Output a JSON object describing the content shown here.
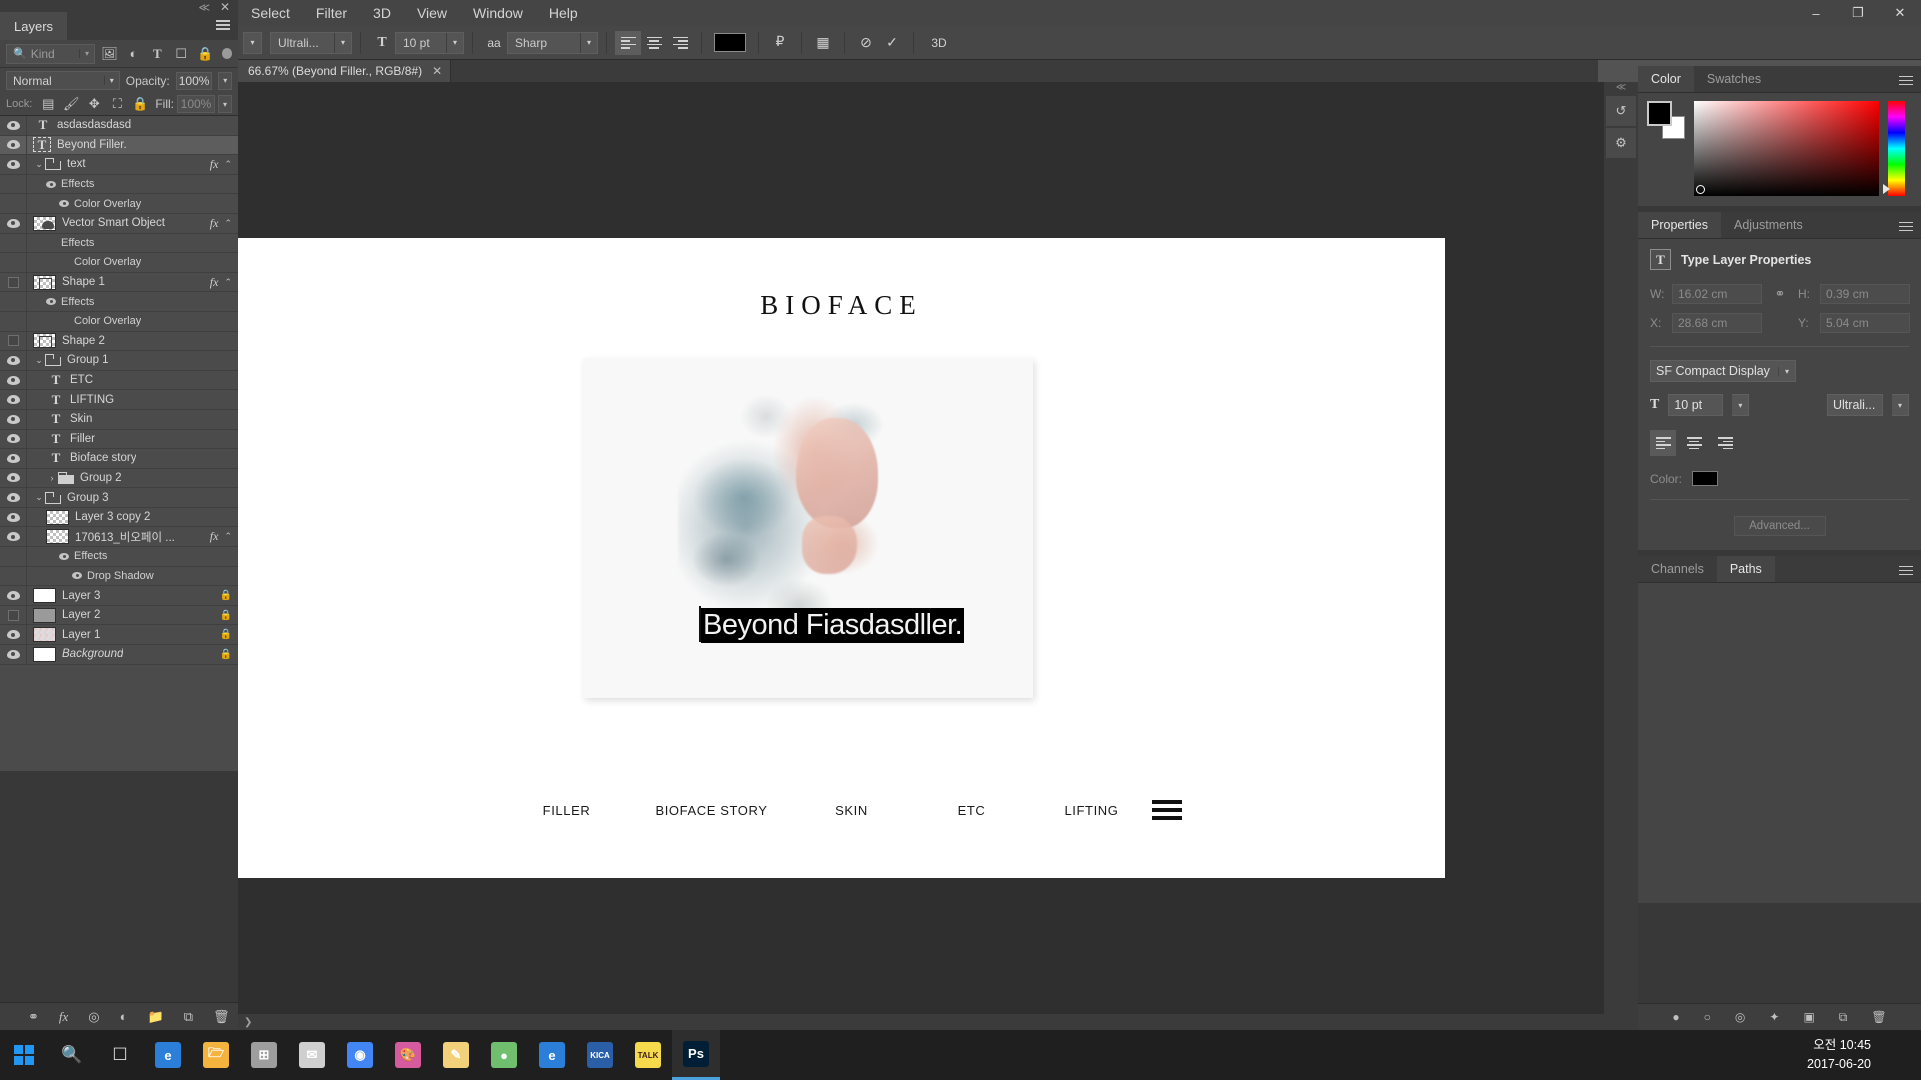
{
  "menubar": {
    "items": [
      "Select",
      "Filter",
      "3D",
      "View",
      "Window",
      "Help"
    ],
    "window_controls": {
      "minimize": "–",
      "maximize": "❐",
      "close": "✕"
    }
  },
  "options_bar": {
    "font_family": "Ultrali...",
    "font_size": "10 pt",
    "antialias_label": "aa",
    "antialias_value": "Sharp",
    "color_swatch": "#000000",
    "align_left": "align-left",
    "align_center": "align-center",
    "align_right": "align-right",
    "warp_text": "warp-text-icon",
    "char_panel": "character-panel-icon",
    "cancel": "cancel-icon",
    "commit": "commit-icon",
    "threed": "3D"
  },
  "layers_panel": {
    "tab_label": "Layers",
    "filter_placeholder": "Kind",
    "filter_icons": [
      "image-filter-icon",
      "adjustment-filter-icon",
      "type-filter-icon",
      "shape-filter-icon",
      "smartobject-filter-icon"
    ],
    "blend_mode": "Normal",
    "opacity_label": "Opacity:",
    "opacity_value": "100%",
    "lock_label": "Lock:",
    "fill_label": "Fill:",
    "fill_value": "100%",
    "lock_icons": [
      "lock-transparent-icon",
      "lock-image-icon",
      "lock-position-icon",
      "lock-artboard-icon",
      "lock-all-icon"
    ],
    "rows": [
      {
        "kind": "type",
        "name": "asdasdasdasd",
        "visible": true,
        "indent": 0,
        "selected": false,
        "fx": false
      },
      {
        "kind": "type-boxed",
        "name": "Beyond Filler.",
        "visible": true,
        "indent": 0,
        "selected": true,
        "fx": false
      },
      {
        "kind": "group-open",
        "name": "text",
        "visible": true,
        "indent": 0,
        "selected": false,
        "fx": true
      },
      {
        "kind": "effects",
        "name": "Effects",
        "visible": true,
        "indent": 1,
        "selected": false,
        "fx": false
      },
      {
        "kind": "effect-item",
        "name": "Color Overlay",
        "visible": true,
        "indent": 2,
        "selected": false,
        "fx": false
      },
      {
        "kind": "smart-object",
        "name": "Vector Smart Object",
        "visible": true,
        "indent": 0,
        "selected": false,
        "fx": true
      },
      {
        "kind": "effects-noeye",
        "name": "Effects",
        "visible": false,
        "indent": 1,
        "selected": false,
        "fx": false
      },
      {
        "kind": "effect-item-noeye",
        "name": "Color Overlay",
        "visible": false,
        "indent": 2,
        "selected": false,
        "fx": false
      },
      {
        "kind": "shape",
        "name": "Shape 1",
        "visible": false,
        "indent": 0,
        "selected": false,
        "fx": true
      },
      {
        "kind": "effects",
        "name": "Effects",
        "visible": true,
        "indent": 1,
        "selected": false,
        "fx": false
      },
      {
        "kind": "effect-item-noeye",
        "name": "Color Overlay",
        "visible": false,
        "indent": 2,
        "selected": false,
        "fx": false
      },
      {
        "kind": "shape",
        "name": "Shape 2",
        "visible": false,
        "indent": 0,
        "selected": false,
        "fx": false
      },
      {
        "kind": "group-open",
        "name": "Group 1",
        "visible": true,
        "indent": 0,
        "selected": false,
        "fx": false
      },
      {
        "kind": "type",
        "name": "ETC",
        "visible": true,
        "indent": 1,
        "selected": false,
        "fx": false
      },
      {
        "kind": "type",
        "name": "LIFTING",
        "visible": true,
        "indent": 1,
        "selected": false,
        "fx": false
      },
      {
        "kind": "type",
        "name": "Skin",
        "visible": true,
        "indent": 1,
        "selected": false,
        "fx": false
      },
      {
        "kind": "type",
        "name": "Filler",
        "visible": true,
        "indent": 1,
        "selected": false,
        "fx": false
      },
      {
        "kind": "type",
        "name": "Bioface story",
        "visible": true,
        "indent": 1,
        "selected": false,
        "fx": false
      },
      {
        "kind": "group-closed",
        "name": "Group 2",
        "visible": true,
        "indent": 1,
        "selected": false,
        "fx": false
      },
      {
        "kind": "group-open",
        "name": "Group 3",
        "visible": true,
        "indent": 0,
        "selected": false,
        "fx": false
      },
      {
        "kind": "raster",
        "name": "Layer 3 copy 2",
        "visible": true,
        "indent": 1,
        "selected": false,
        "fx": false
      },
      {
        "kind": "raster",
        "name": "170613_비오페이 ...",
        "visible": true,
        "indent": 1,
        "selected": false,
        "fx": true
      },
      {
        "kind": "effects",
        "name": "Effects",
        "visible": true,
        "indent": 2,
        "selected": false,
        "fx": false
      },
      {
        "kind": "effect-item",
        "name": "Drop Shadow",
        "visible": true,
        "indent": 3,
        "selected": false,
        "fx": false
      },
      {
        "kind": "raster-white",
        "name": "Layer 3",
        "visible": true,
        "indent": 0,
        "selected": false,
        "locked": true
      },
      {
        "kind": "raster-photo",
        "name": "Layer 2",
        "visible": false,
        "indent": 0,
        "selected": false,
        "locked": true
      },
      {
        "kind": "raster-photo2",
        "name": "Layer 1",
        "visible": true,
        "indent": 0,
        "selected": false,
        "locked": true
      },
      {
        "kind": "raster-white",
        "name": "Background",
        "visible": true,
        "indent": 0,
        "selected": false,
        "locked": true,
        "italic": true
      }
    ],
    "bottom_icons": [
      "link-layers-icon",
      "add-style-icon",
      "add-mask-icon",
      "adjustment-layer-icon",
      "new-group-icon",
      "new-layer-icon",
      "delete-layer-icon"
    ]
  },
  "document": {
    "tab_title": "66.67% (Beyond Filler., RGB/8#)",
    "close_glyph": "✕"
  },
  "canvas": {
    "brand_title": "BIOFACE",
    "selected_text": "Beyond Fiasdasdller.",
    "nav_items": [
      "FILLER",
      "BIOFACE STORY",
      "SKIN",
      "ETC",
      "LIFTING"
    ],
    "hamburger": "hamburger-menu-icon"
  },
  "right_rail": {
    "icons": [
      "history-icon",
      "properties-rail-icon"
    ]
  },
  "color_panel": {
    "tabs": [
      "Color",
      "Swatches"
    ],
    "active_tab": "Color",
    "foreground": "#000000",
    "background": "#ffffff"
  },
  "properties_panel": {
    "tabs": [
      "Properties",
      "Adjustments"
    ],
    "active_tab": "Properties",
    "title": "Type Layer Properties",
    "w_label": "W:",
    "w_value": "16.02 cm",
    "h_label": "H:",
    "h_value": "0.39 cm",
    "x_label": "X:",
    "x_value": "28.68 cm",
    "y_label": "Y:",
    "y_value": "5.04 cm",
    "link_icon": "link-dimensions-icon",
    "font_family": "SF Compact Display",
    "font_size": "10 pt",
    "font_style": "Ultrali...",
    "align_icons": [
      "align-left-icon",
      "align-center-icon",
      "align-right-icon"
    ],
    "color_label": "Color:",
    "color_value": "#000000",
    "advanced_label": "Advanced..."
  },
  "paths_panel": {
    "tabs": [
      "Channels",
      "Paths"
    ],
    "active_tab": "Paths",
    "bottom_icons": [
      "fill-path-icon",
      "stroke-path-icon",
      "load-selection-icon",
      "make-work-path-icon",
      "add-mask-icon",
      "new-path-icon",
      "delete-path-icon"
    ]
  },
  "taskbar": {
    "start": "windows-start-icon",
    "search": "search-icon",
    "taskview": "task-view-icon",
    "apps": [
      {
        "name": "edge-icon",
        "label": "e",
        "color": "#2c7fd8"
      },
      {
        "name": "file-explorer-icon",
        "label": "🗁",
        "color": "#f3b33d"
      },
      {
        "name": "store-icon",
        "label": "⊞",
        "color": "#9e9e9e"
      },
      {
        "name": "mail-icon",
        "label": "✉",
        "color": "#cfcfcf"
      },
      {
        "name": "chrome-icon",
        "label": "◉",
        "color": "#4285f4"
      },
      {
        "name": "paint-icon",
        "label": "🎨",
        "color": "#d65a9e"
      },
      {
        "name": "notepad-icon",
        "label": "✎",
        "color": "#f2d17a"
      },
      {
        "name": "browser2-icon",
        "label": "●",
        "color": "#6fbf6f"
      },
      {
        "name": "edge2-icon",
        "label": "e",
        "color": "#2c7fd8"
      },
      {
        "name": "kica-icon",
        "label": "KICA",
        "color": "#2a5fa8"
      },
      {
        "name": "kakaotalk-icon",
        "label": "TALK",
        "color": "#f7d94c"
      },
      {
        "name": "photoshop-icon",
        "label": "Ps",
        "color": "#001e36"
      }
    ],
    "time": "오전 10:45",
    "date": "2017-06-20"
  }
}
